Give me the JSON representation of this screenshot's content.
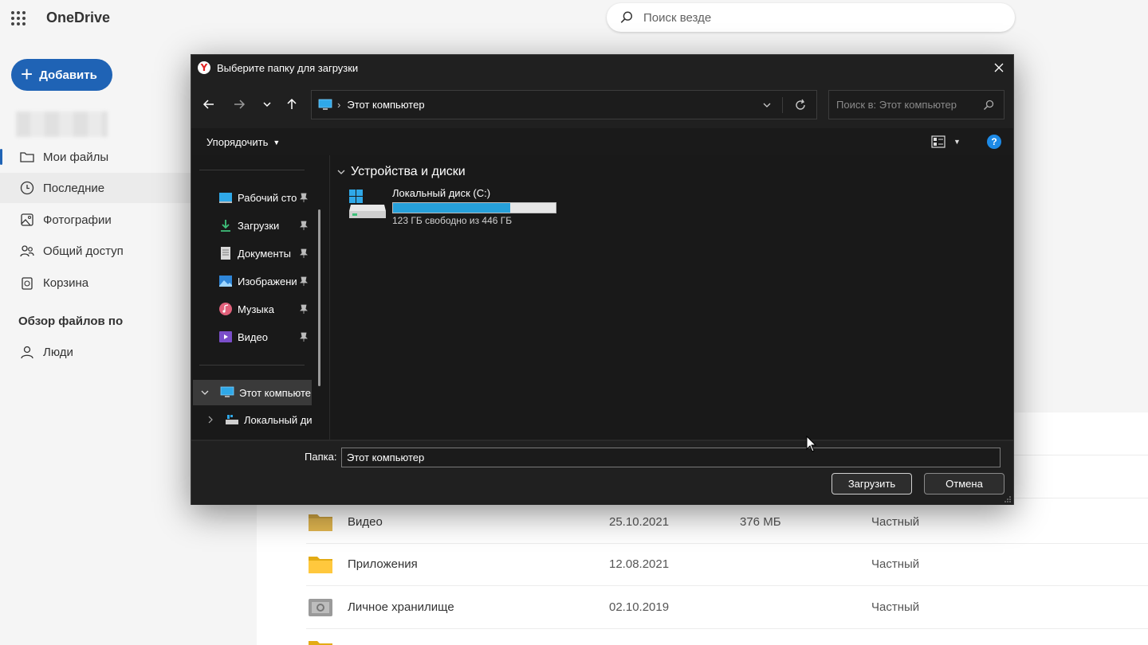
{
  "onedrive": {
    "brand": "OneDrive",
    "search_placeholder": "Поиск везде",
    "add_button": "Добавить",
    "nav": [
      {
        "label": "Мои файлы",
        "icon": "folder-icon"
      },
      {
        "label": "Последние",
        "icon": "clock-icon"
      },
      {
        "label": "Фотографии",
        "icon": "photo-icon"
      },
      {
        "label": "Общий доступ",
        "icon": "people-icon"
      },
      {
        "label": "Корзина",
        "icon": "recycle-bin-icon"
      }
    ],
    "browse_heading": "Обзор файлов по",
    "people": "Люди",
    "files": [
      {
        "name": "Видео",
        "date": "25.10.2021",
        "size": "376 МБ",
        "sharing": "Частный",
        "icon": "folder-icon"
      },
      {
        "name": "Приложения",
        "date": "12.08.2021",
        "size": "",
        "sharing": "Частный",
        "icon": "folder-icon"
      },
      {
        "name": "Личное хранилище",
        "date": "02.10.2019",
        "size": "",
        "sharing": "Частный",
        "icon": "vault-icon"
      }
    ]
  },
  "dialog": {
    "title": "Выберите папку для загрузки",
    "address_path": "Этот компьютер",
    "search_placeholder": "Поиск в: Этот компьютер",
    "organize": "Упорядочить",
    "help": "?",
    "quick_access": [
      {
        "label": "Рабочий сто",
        "icon": "desktop-icon"
      },
      {
        "label": "Загрузки",
        "icon": "download-icon"
      },
      {
        "label": "Документы",
        "icon": "document-icon"
      },
      {
        "label": "Изображени",
        "icon": "picture-icon"
      },
      {
        "label": "Музыка",
        "icon": "music-icon"
      },
      {
        "label": "Видео",
        "icon": "video-icon"
      }
    ],
    "tree_this_pc": "Этот компьюте",
    "tree_local_disk": "Локальный ди",
    "group_header": "Устройства и диски",
    "drive": {
      "name": "Локальный диск (C:)",
      "free_text": "123 ГБ свободно из 446 ГБ",
      "used_fraction": 0.72
    },
    "folder_label": "Папка:",
    "folder_value": "Этот компьютер",
    "upload_button": "Загрузить",
    "cancel_button": "Отмена"
  },
  "colors": {
    "accent": "#1f63b5",
    "dialog_bg": "#202020",
    "drive_bar": "#26a0da"
  }
}
